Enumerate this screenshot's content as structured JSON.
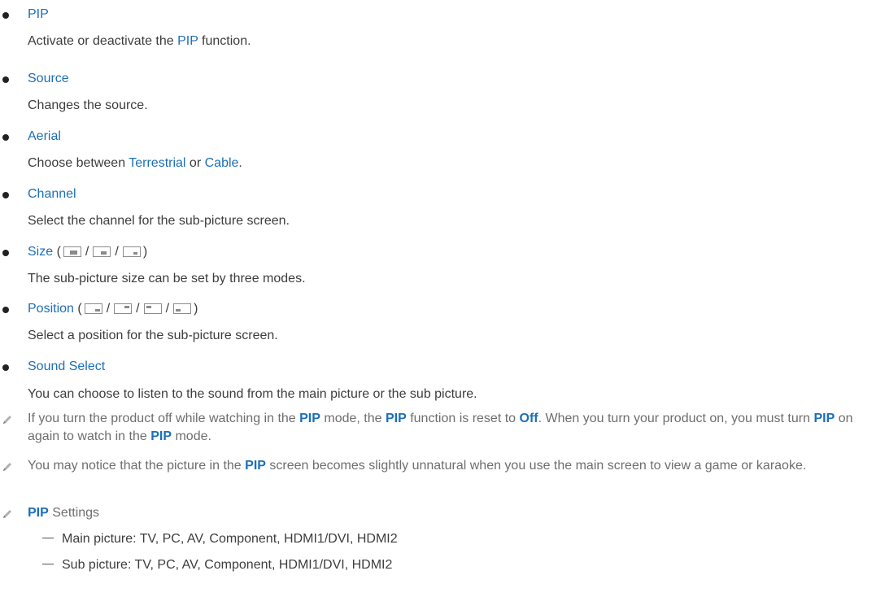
{
  "items": [
    {
      "title": "PIP",
      "desc_parts": [
        "Activate or deactivate the ",
        "PIP",
        " function."
      ]
    },
    {
      "title": "Source",
      "desc": "Changes the source."
    },
    {
      "title": "Aerial",
      "desc_parts": [
        "Choose between ",
        "Terrestrial",
        " or ",
        "Cable",
        "."
      ]
    },
    {
      "title": "Channel",
      "desc": "Select the channel for the sub-picture screen."
    },
    {
      "title": "Size",
      "desc": "The sub-picture size can be set by three modes.",
      "icons": [
        "size-large-icon",
        "size-medium-icon",
        "size-small-icon"
      ]
    },
    {
      "title": "Position",
      "desc": "Select a position for the sub-picture screen.",
      "icons": [
        "position-bottom-right-icon",
        "position-top-right-icon",
        "position-top-left-icon",
        "position-bottom-left-icon"
      ]
    },
    {
      "title": "Sound Select",
      "desc": "You can choose to listen to the sound from the main picture or the sub picture."
    }
  ],
  "notes": [
    {
      "parts": [
        "If you turn the product off while watching in the ",
        "PIP",
        " mode, the ",
        "PIP",
        " function is reset to ",
        "Off",
        ". When you turn your product on, you must turn ",
        "PIP",
        " on again to watch in the ",
        "PIP",
        " mode."
      ]
    },
    {
      "parts": [
        "You may notice that the picture in the ",
        "PIP",
        " screen becomes slightly unnatural when you use the main screen to view a game or karaoke."
      ]
    },
    {
      "parts": [
        "PIP",
        " Settings"
      ],
      "sub": [
        "Main picture: TV, PC, AV, Component, HDMI1/DVI, HDMI2",
        "Sub picture: TV, PC, AV, Component, HDMI1/DVI, HDMI2"
      ]
    }
  ],
  "punct": {
    "open": "(",
    "close": ")",
    "slash": "/"
  },
  "colors": {
    "accent": "#1c6fb8",
    "text": "#3d3d3d",
    "note": "#6e6e6e"
  }
}
